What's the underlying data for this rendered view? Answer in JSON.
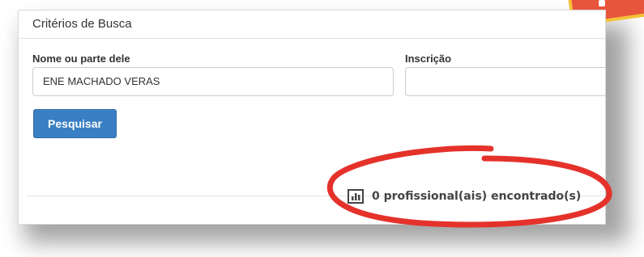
{
  "panel": {
    "title": "Critérios de Busca"
  },
  "form": {
    "name_label": "Nome ou parte dele",
    "name_value": "ENE MACHADO VERAS",
    "inscricao_label": "Inscrição",
    "inscricao_value": ""
  },
  "actions": {
    "search_label": "Pesquisar"
  },
  "results": {
    "summary": "0 profissional(ais) encontrado(s)"
  },
  "colors": {
    "primary_button": "#3a7fc3",
    "annotation_ring": "#e4322b"
  },
  "icons": {
    "results": "bar-chart-icon"
  }
}
